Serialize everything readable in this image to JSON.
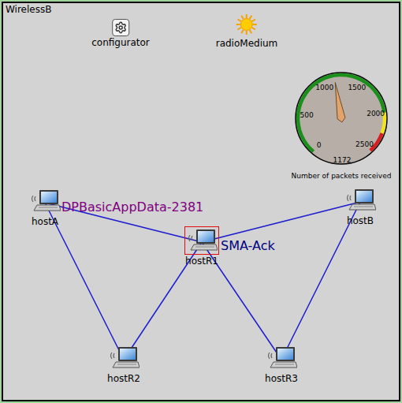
{
  "canvas": {
    "title": "WirelessB"
  },
  "modules": [
    {
      "name": "configurator",
      "kind": "gear"
    },
    {
      "name": "radioMedium",
      "kind": "sun"
    }
  ],
  "gauge": {
    "label": "Number of packets received",
    "reading": "1172",
    "level": 0.4688,
    "ticks": [
      "0",
      "500",
      "1000",
      "1500",
      "2000",
      "2500"
    ],
    "bands": [
      {
        "from": 0,
        "to": 0.8,
        "color": "#1a8f1a"
      },
      {
        "from": 0.8,
        "to": 0.9,
        "color": "#f2e31a"
      },
      {
        "from": 0.9,
        "to": 1,
        "color": "#d81e1e"
      }
    ]
  },
  "hosts": [
    {
      "name": "hostA",
      "selected": false
    },
    {
      "name": "hostR1",
      "selected": true
    },
    {
      "name": "hostB",
      "selected": false
    },
    {
      "name": "hostR2",
      "selected": false
    },
    {
      "name": "hostR3",
      "selected": false
    }
  ],
  "links": [
    {
      "from": "hostA",
      "to": "hostR1"
    },
    {
      "from": "hostR1",
      "to": "hostB"
    },
    {
      "from": "hostA",
      "to": "hostR2"
    },
    {
      "from": "hostR2",
      "to": "hostR1"
    },
    {
      "from": "hostR1",
      "to": "hostR3"
    },
    {
      "from": "hostR3",
      "to": "hostB"
    }
  ],
  "messages": [
    {
      "text": "DPBasicAppData-2381",
      "color": "#800080"
    },
    {
      "text": "SMA-Ack",
      "color": "#000080"
    }
  ]
}
